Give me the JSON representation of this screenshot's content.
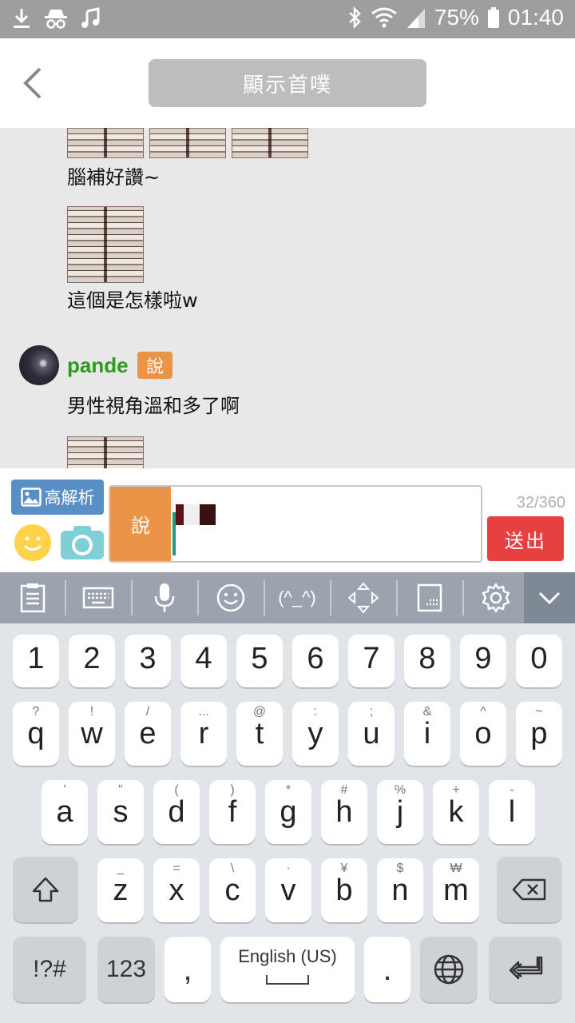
{
  "status_bar": {
    "battery": "75%",
    "time": "01:40",
    "icons_left": [
      "download-icon",
      "incognito-icon",
      "music-icon"
    ],
    "icons_right": [
      "bluetooth-icon",
      "wifi-icon",
      "signal-icon",
      "battery-icon"
    ]
  },
  "header": {
    "back_icon": "chevron-left-icon",
    "title_button": "顯示首噗"
  },
  "chat": {
    "messages": [
      {
        "text": "腦補好讚~"
      },
      {
        "text": "這個是怎樣啦w"
      },
      {
        "user": "pande",
        "qualifier": "說",
        "text": "男性視角溫和多了啊"
      }
    ]
  },
  "input": {
    "hires_label": "高解析",
    "mode_label": "說",
    "counter": "32/360",
    "send_label": "送出"
  },
  "keyboard": {
    "toolbar": [
      "clipboard-icon",
      "keyboard-icon",
      "microphone-icon",
      "emoji-icon",
      "(^_^)",
      "cursor-move-icon",
      "one-handed-icon",
      "settings-icon",
      "chevron-down-icon"
    ],
    "kaomoji_label": "(^_^)",
    "number_row": [
      "1",
      "2",
      "3",
      "4",
      "5",
      "6",
      "7",
      "8",
      "9",
      "0"
    ],
    "row1": [
      {
        "key": "q",
        "sec": "?"
      },
      {
        "key": "w",
        "sec": "!"
      },
      {
        "key": "e",
        "sec": "/"
      },
      {
        "key": "r",
        "sec": "..."
      },
      {
        "key": "t",
        "sec": "@"
      },
      {
        "key": "y",
        "sec": ":"
      },
      {
        "key": "u",
        "sec": ";"
      },
      {
        "key": "i",
        "sec": "&"
      },
      {
        "key": "o",
        "sec": "^"
      },
      {
        "key": "p",
        "sec": "~"
      }
    ],
    "row2": [
      {
        "key": "a",
        "sec": "'"
      },
      {
        "key": "s",
        "sec": "\""
      },
      {
        "key": "d",
        "sec": "("
      },
      {
        "key": "f",
        "sec": ")"
      },
      {
        "key": "g",
        "sec": "*"
      },
      {
        "key": "h",
        "sec": "#"
      },
      {
        "key": "j",
        "sec": "%"
      },
      {
        "key": "k",
        "sec": "+"
      },
      {
        "key": "l",
        "sec": "-"
      }
    ],
    "row3": [
      {
        "key": "z",
        "sec": "_"
      },
      {
        "key": "x",
        "sec": "="
      },
      {
        "key": "c",
        "sec": "\\"
      },
      {
        "key": "v",
        "sec": "·"
      },
      {
        "key": "b",
        "sec": "¥"
      },
      {
        "key": "n",
        "sec": "$"
      },
      {
        "key": "m",
        "sec": "₩"
      }
    ],
    "symbols_label": "!?#",
    "numbers_label": "123",
    "comma_label": ",",
    "space_label": "English (US)",
    "period_label": "."
  }
}
